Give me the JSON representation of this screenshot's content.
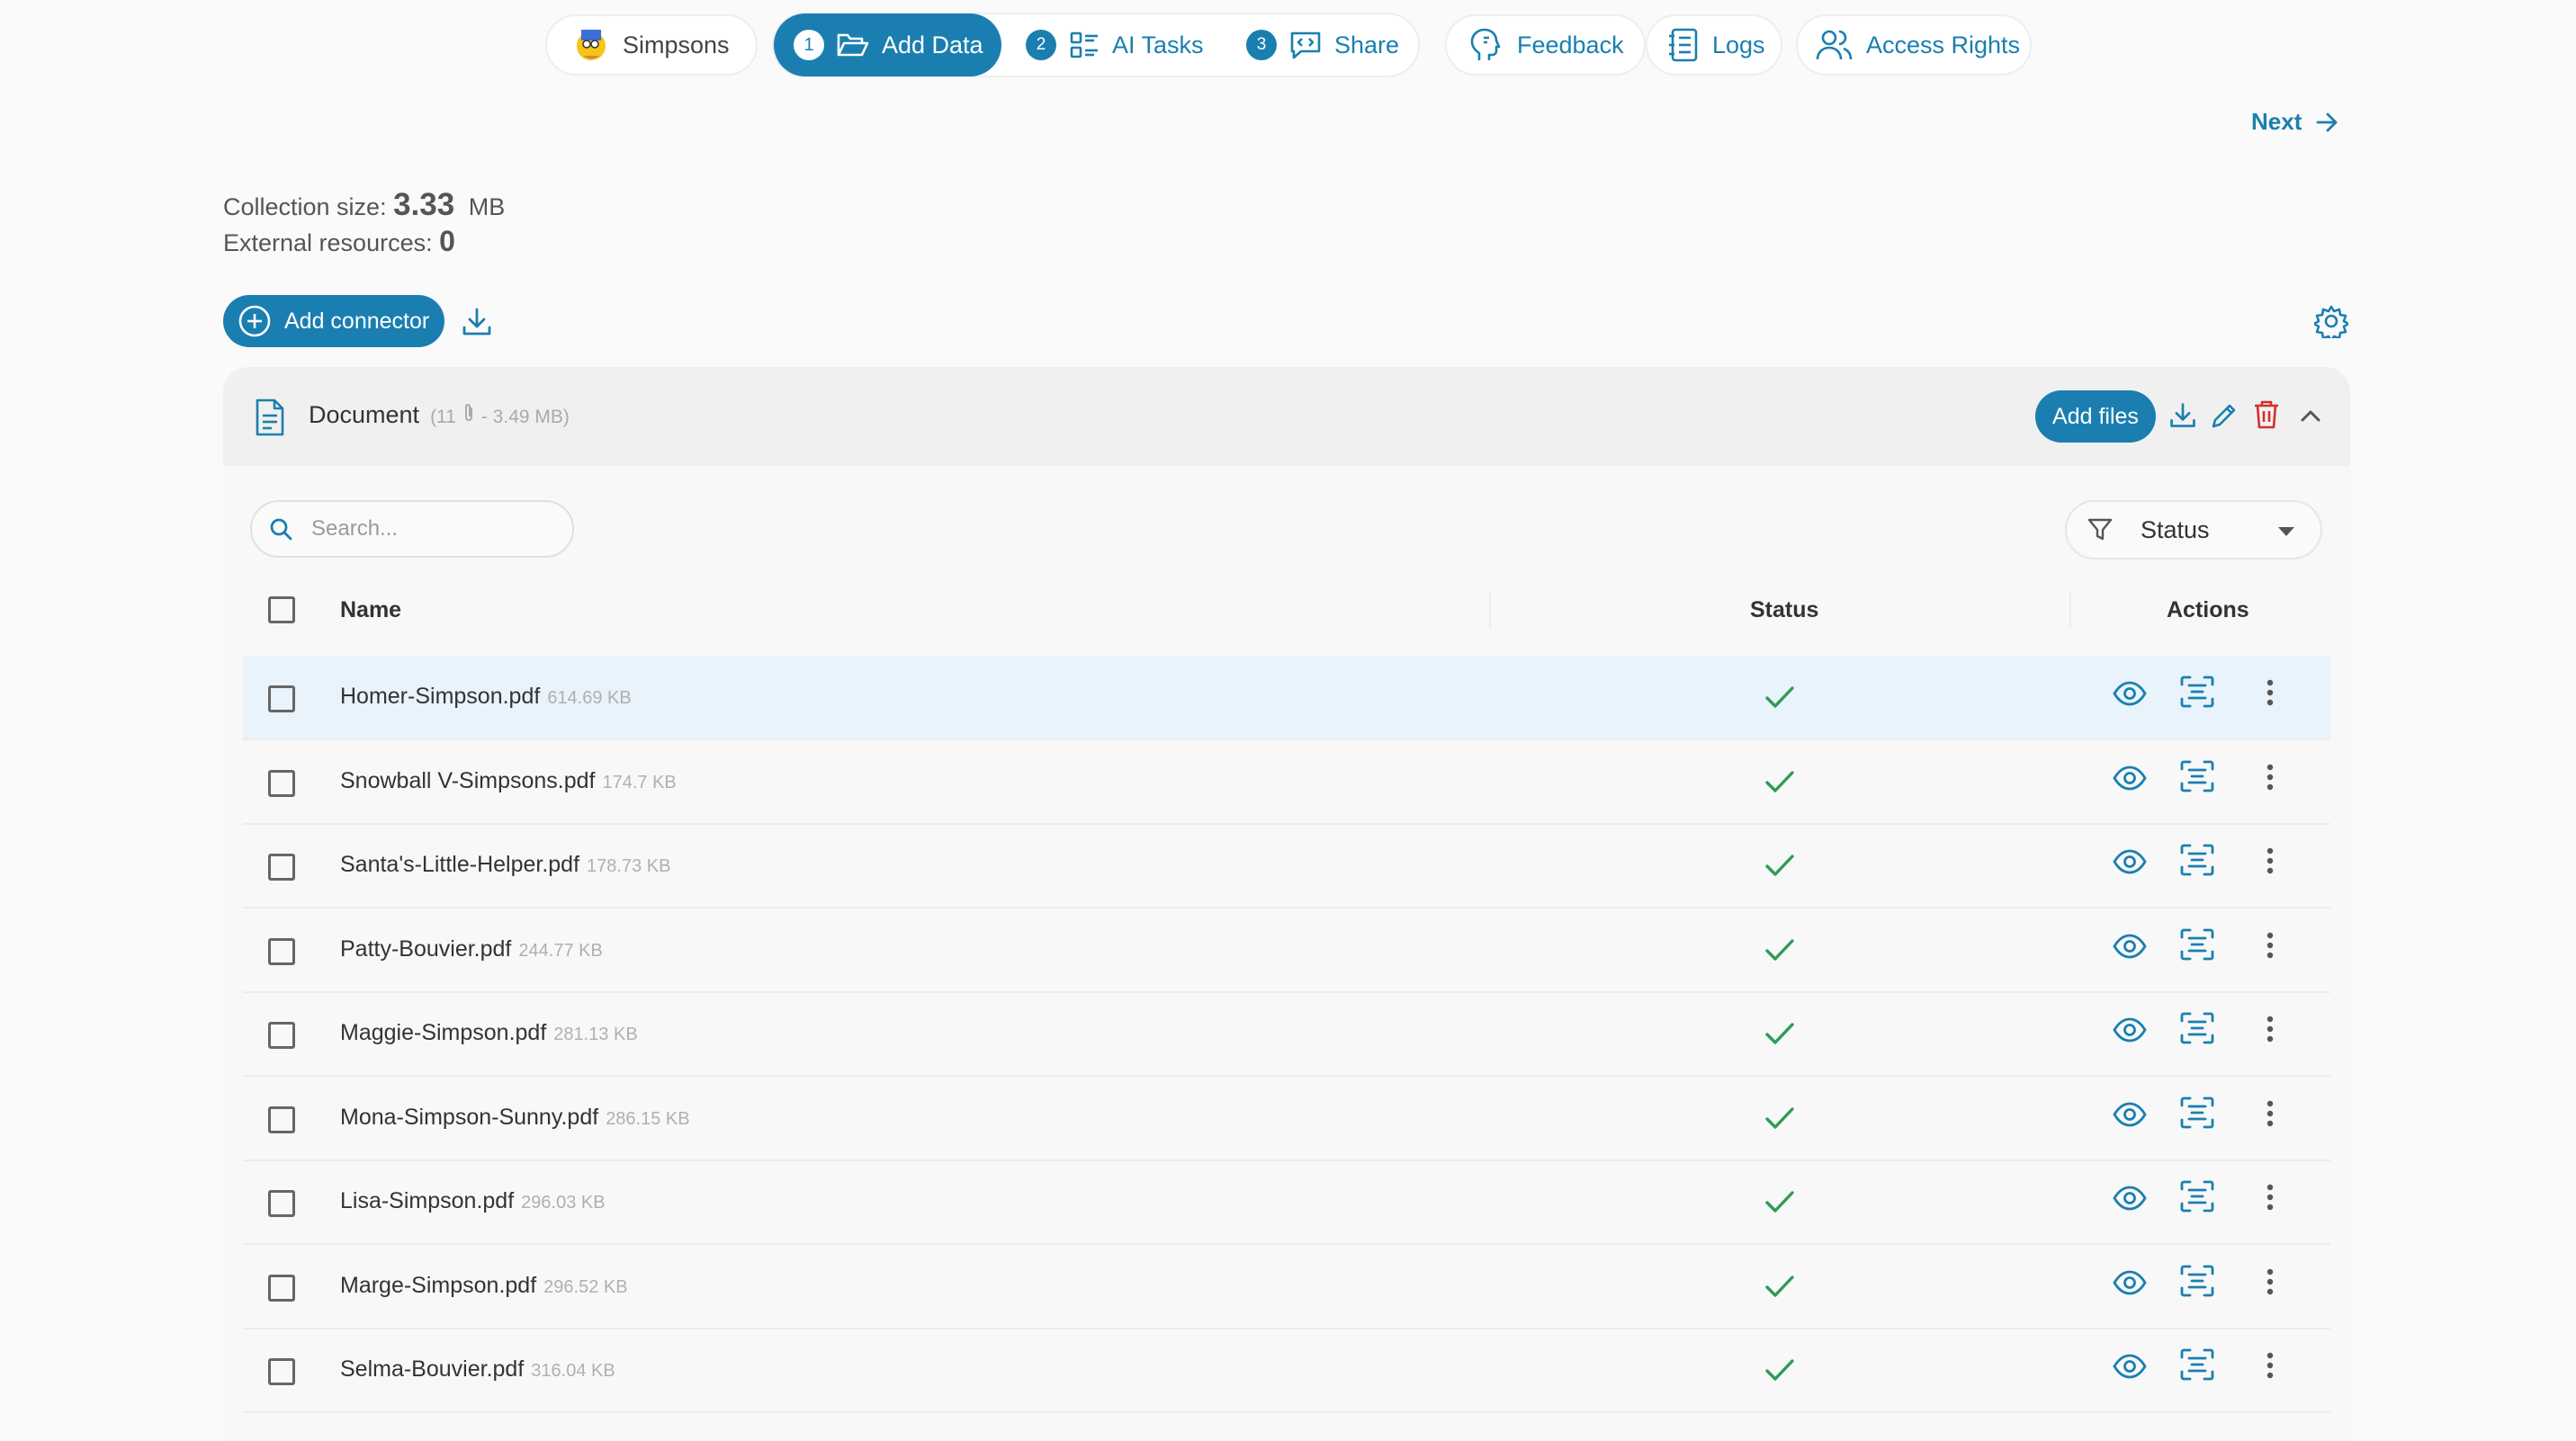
{
  "nav": {
    "project_label": "Simpsons",
    "steps": [
      {
        "num": "1",
        "label": "Add Data"
      },
      {
        "num": "2",
        "label": "AI Tasks"
      },
      {
        "num": "3",
        "label": "Share"
      }
    ],
    "feedback_label": "Feedback",
    "logs_label": "Logs",
    "access_label": "Access Rights"
  },
  "next_label": "Next",
  "stats": {
    "collection_label": "Collection size:",
    "collection_value": "3.33",
    "collection_unit": "MB",
    "external_label": "External resources:",
    "external_value": "0"
  },
  "connector": {
    "add_label": "Add connector"
  },
  "card": {
    "title": "Document",
    "meta_prefix": "(11",
    "meta_suffix": "- 3.49 MB)",
    "add_files_label": "Add files",
    "search_placeholder": "Search...",
    "status_filter_label": "Status",
    "columns": {
      "name": "Name",
      "status": "Status",
      "actions": "Actions"
    }
  },
  "files": [
    {
      "name": "Homer-Simpson.pdf",
      "size": "614.69 KB",
      "status": "done"
    },
    {
      "name": "Snowball V-Simpsons.pdf",
      "size": "174.7 KB",
      "status": "done"
    },
    {
      "name": "Santa's-Little-Helper.pdf",
      "size": "178.73 KB",
      "status": "done"
    },
    {
      "name": "Patty-Bouvier.pdf",
      "size": "244.77 KB",
      "status": "done"
    },
    {
      "name": "Maggie-Simpson.pdf",
      "size": "281.13 KB",
      "status": "done"
    },
    {
      "name": "Mona-Simpson-Sunny.pdf",
      "size": "286.15 KB",
      "status": "done"
    },
    {
      "name": "Lisa-Simpson.pdf",
      "size": "296.03 KB",
      "status": "done"
    },
    {
      "name": "Marge-Simpson.pdf",
      "size": "296.52 KB",
      "status": "done"
    },
    {
      "name": "Selma-Bouvier.pdf",
      "size": "316.04 KB",
      "status": "done"
    }
  ],
  "colors": {
    "accent": "#1a7fb0",
    "success": "#2e9b57",
    "danger": "#d32f2f"
  }
}
